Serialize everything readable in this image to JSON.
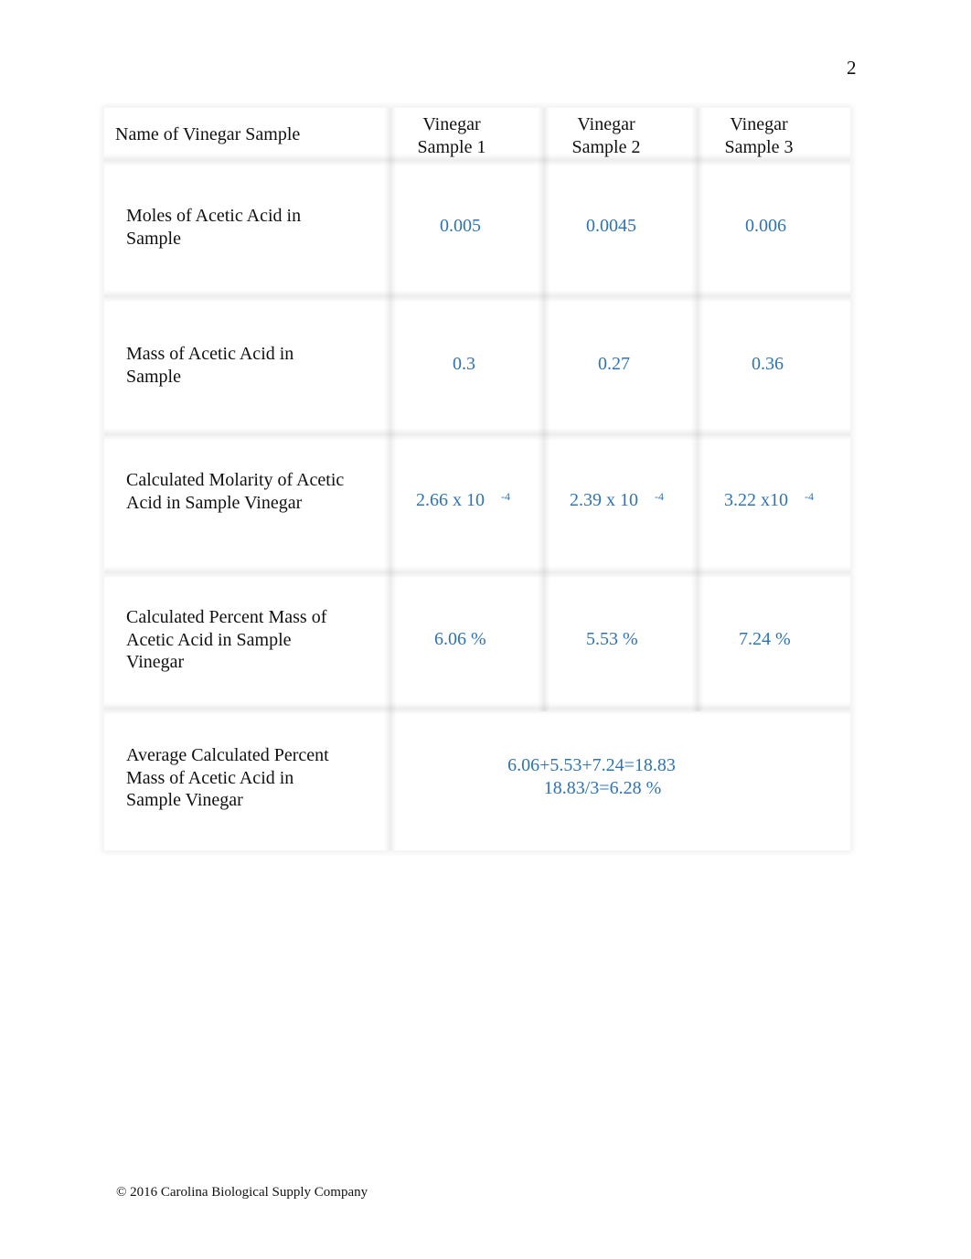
{
  "page": {
    "number": "2"
  },
  "table": {
    "header": {
      "label": "Name of Vinegar Sample",
      "columns": [
        {
          "line1": "Vinegar",
          "line2": "Sample 1"
        },
        {
          "line1": "Vinegar",
          "line2": "Sample 2"
        },
        {
          "line1": "Vinegar",
          "line2": "Sample 3"
        }
      ]
    },
    "rows": [
      {
        "label": "Moles of Acetic Acid in Sample",
        "values": [
          "0.005",
          "0.0045",
          "0.006"
        ]
      },
      {
        "label": "Mass of Acetic Acid in Sample",
        "values": [
          "0.3",
          "0.27",
          "0.36"
        ]
      },
      {
        "label": "Calculated Molarity of Acetic Acid in Sample Vinegar",
        "values": [
          "2.66 x 10",
          "2.39 x 10",
          "3.22 x10"
        ],
        "exponents": [
          "-4",
          "-4",
          "-4"
        ]
      },
      {
        "label": "Calculated Percent Mass of Acetic Acid in Sample Vinegar",
        "values": [
          "6.06 %",
          "5.53 %",
          "7.24 %"
        ]
      }
    ],
    "average": {
      "label": "Average Calculated Percent Mass of Acetic Acid in Sample Vinegar",
      "line1": "6.06+5.53+7.24=18.83",
      "line2": "18.83/3=6.28 %"
    }
  },
  "footer": {
    "copyright": "© 2016 Carolina Biological Supply Company"
  },
  "colors": {
    "value_text": "#2e74b5"
  }
}
